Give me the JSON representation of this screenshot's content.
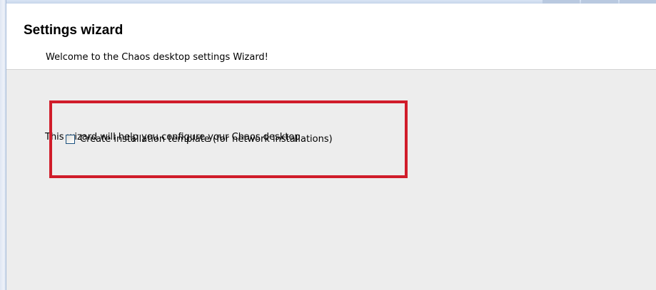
{
  "wizard": {
    "title": "Settings wizard",
    "subtitle": "Welcome to the Chaos desktop settings Wizard!"
  },
  "body": {
    "intro": "This wizard will help you configure your Chaos desktop",
    "options": [
      {
        "label": "Create installation template (for network installations)",
        "checked": false
      }
    ]
  },
  "colors": {
    "highlight_border": "#d01c2a",
    "body_background": "#ededed",
    "header_background": "#ffffff"
  }
}
